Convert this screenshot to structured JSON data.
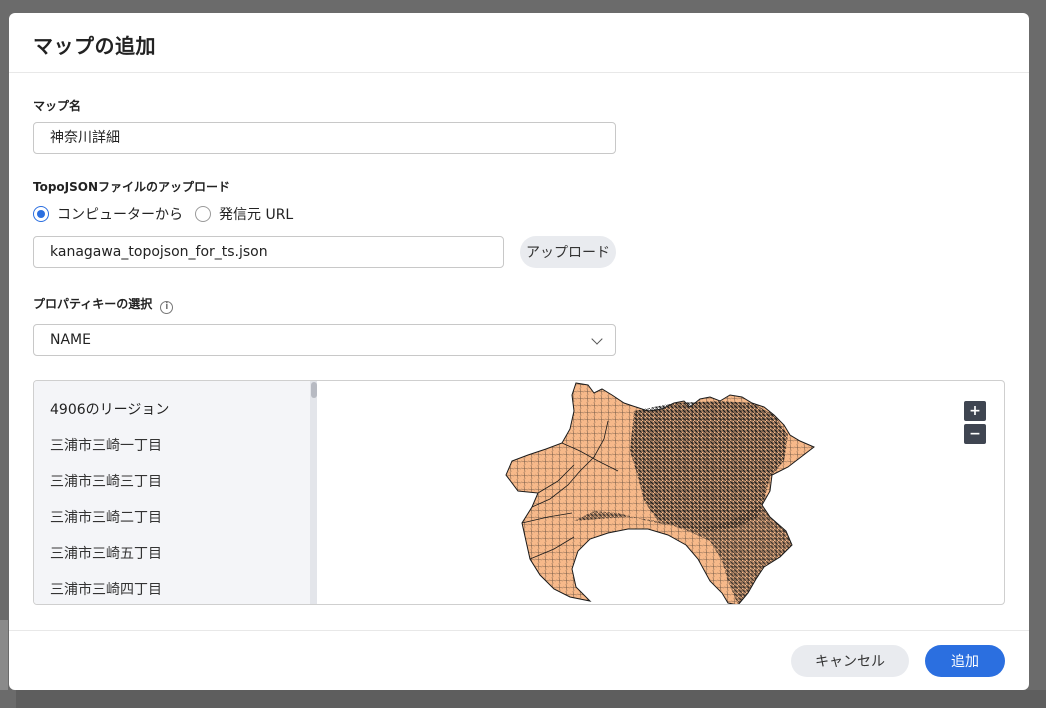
{
  "dialog": {
    "title": "マップの追加"
  },
  "map_name": {
    "label": "マップ名",
    "value": "神奈川詳細"
  },
  "upload": {
    "label": "TopoJSONファイルのアップロード",
    "options": [
      {
        "label": "コンピューターから",
        "selected": true
      },
      {
        "label": "発信元 URL",
        "selected": false
      }
    ],
    "file_name": "kanagawa_topojson_for_ts.json",
    "button_label": "アップロード"
  },
  "property_key": {
    "label": "プロパティキーの選択",
    "info_icon": "info-icon",
    "selected": "NAME"
  },
  "regions": {
    "header": "4906のリージョン",
    "items": [
      "三浦市三崎一丁目",
      "三浦市三崎三丁目",
      "三浦市三崎二丁目",
      "三浦市三崎五丁目",
      "三浦市三崎四丁目"
    ]
  },
  "map_controls": {
    "zoom_in": "+",
    "zoom_out": "−"
  },
  "colors": {
    "accent": "#2b6fe0",
    "map_fill": "#f7b98a",
    "map_stroke": "#1a1a1a"
  },
  "footer": {
    "cancel_label": "キャンセル",
    "add_label": "追加"
  }
}
